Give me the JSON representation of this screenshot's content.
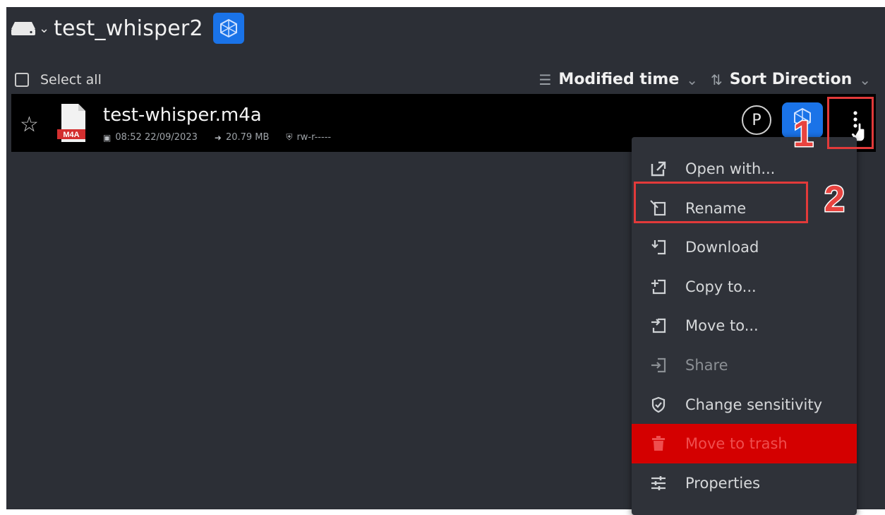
{
  "header": {
    "title": "test_whisper2",
    "drive_icon": "drive-icon",
    "dropdown_icon": "chevron-down-icon",
    "badge_icon": "cube-icon"
  },
  "toolbar": {
    "select_all": "Select all",
    "sort_field": "Modified time",
    "sort_direction": "Sort Direction"
  },
  "file": {
    "name": "test-whisper.m4a",
    "type_badge": "M4A",
    "modified": "08:52 22/09/2023",
    "size": "20.79 MB",
    "permissions": "rw-r-----",
    "owner_initial": "P"
  },
  "menu": {
    "items": [
      {
        "label": "Open with...",
        "icon": "open-external-icon",
        "state": "normal"
      },
      {
        "label": "Rename",
        "icon": "rename-icon",
        "state": "normal"
      },
      {
        "label": "Download",
        "icon": "download-icon",
        "state": "normal"
      },
      {
        "label": "Copy to...",
        "icon": "copy-icon",
        "state": "normal"
      },
      {
        "label": "Move to...",
        "icon": "move-icon",
        "state": "normal"
      },
      {
        "label": "Share",
        "icon": "share-icon",
        "state": "disabled"
      },
      {
        "label": "Change sensitivity",
        "icon": "shield-check-icon",
        "state": "normal"
      },
      {
        "label": "Move to trash",
        "icon": "trash-icon",
        "state": "danger"
      },
      {
        "label": "Properties",
        "icon": "sliders-icon",
        "state": "normal"
      }
    ]
  },
  "annotations": {
    "step1": "1",
    "step2": "2",
    "highlight_color": "#e23a3a"
  },
  "colors": {
    "background": "#2c2f36",
    "row_background": "#000000",
    "accent_blue": "#1a73e8",
    "danger": "#d40000"
  }
}
